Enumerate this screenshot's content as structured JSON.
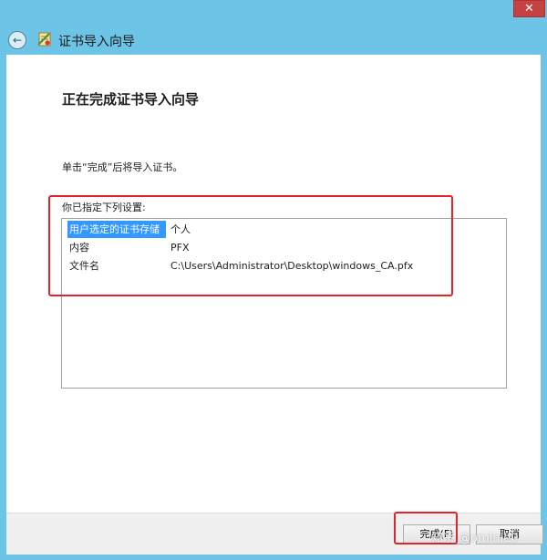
{
  "window": {
    "title": "证书导入向导",
    "close_glyph": "✕",
    "back_glyph": "←"
  },
  "page": {
    "heading": "正在完成证书导入向导",
    "instruction": "单击“完成”后将导入证书。",
    "settings_label": "你已指定下列设置:"
  },
  "settings": {
    "rows": [
      {
        "key": "用户选定的证书存储",
        "value": "个人"
      },
      {
        "key": "内容",
        "value": "PFX"
      },
      {
        "key": "文件名",
        "value": "C:\\Users\\Administrator\\Desktop\\windows_CA.pfx"
      }
    ]
  },
  "buttons": {
    "finish": "完成(F)",
    "cancel": "取消"
  },
  "watermark": "知乎 @ominie0",
  "colors": {
    "chrome": "#6cc4e6",
    "selection": "#3399ff",
    "annotation_red": "#e0242a"
  }
}
